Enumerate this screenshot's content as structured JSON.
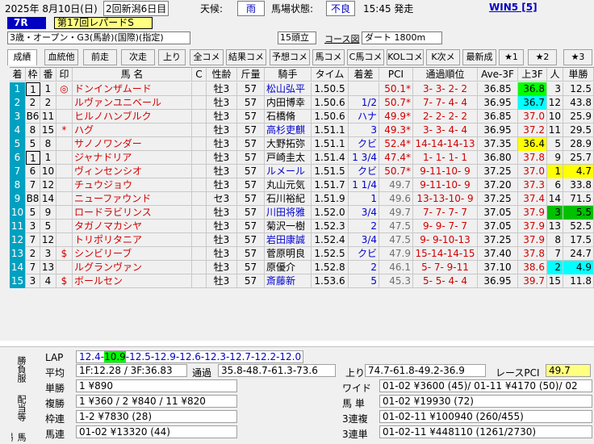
{
  "header": {
    "date": "2025年 8月10日(日)",
    "meeting": "2回新潟6日目",
    "weather_label": "天候:",
    "weather": "雨",
    "track_label": "馬場状態:",
    "track": "不良",
    "start_time": "15:45 発走",
    "win5": "WIN5 [5]"
  },
  "race": {
    "number": "7R",
    "name": "第17回レパードS",
    "conditions": "3歳・オープン・G3(馬齢)(国際)(指定)",
    "runners": "15頭立",
    "course_link": "コース図",
    "distance": "ダート 1800m"
  },
  "tabs": [
    "成績",
    "血統他",
    "前走",
    "次走",
    "上り",
    "全コメ",
    "結果コメ",
    "予想コメ",
    "馬コメ",
    "C馬コメ",
    "KOLコメ",
    "K次メモ",
    "最新成",
    "★1",
    "★2",
    "★3"
  ],
  "columns": {
    "rank": "着",
    "frame": "枠",
    "num": "番",
    "mark": "印",
    "name": "馬 名",
    "c": "C",
    "sex_age": "性齢",
    "weight": "斤量",
    "jockey": "騎手",
    "time": "タイム",
    "margin": "着差",
    "pci": "PCI",
    "passing": "通過順位",
    "ave3f": "Ave-3F",
    "last3f": "上3F",
    "pop": "人",
    "odds": "単勝"
  },
  "runners": [
    {
      "rank": "1",
      "frame": "1",
      "num": "1",
      "mark": "◎",
      "name": "ドンインザムード",
      "c": "",
      "sex_age": "牡3",
      "weight": "57",
      "jockey": "松山弘平",
      "time": "1.50.5",
      "margin": "",
      "pci": "50.1*",
      "passing": "3- 3- 2- 2",
      "ave3f": "36.85",
      "last3f": "36.8",
      "pop": "3",
      "odds": "12.5"
    },
    {
      "rank": "2",
      "frame": "2",
      "num": "2",
      "mark": "",
      "name": "ルヴァンユニベール",
      "c": "",
      "sex_age": "牡3",
      "weight": "57",
      "jockey": "内田博幸",
      "time": "1.50.6",
      "margin": "1/2",
      "pci": "50.7*",
      "passing": "7- 7- 4- 4",
      "ave3f": "36.95",
      "last3f": "36.7",
      "pop": "12",
      "odds": "43.8"
    },
    {
      "rank": "3",
      "frame": "B6",
      "num": "11",
      "mark": "",
      "name": "ヒルノハンブルク",
      "c": "",
      "sex_age": "牡3",
      "weight": "57",
      "jockey": "石橋脩",
      "time": "1.50.6",
      "margin": "ハナ",
      "pci": "49.9*",
      "passing": "2- 2- 2- 2",
      "ave3f": "36.85",
      "last3f": "37.0",
      "pop": "10",
      "odds": "25.9"
    },
    {
      "rank": "4",
      "frame": "8",
      "num": "15",
      "mark": "*",
      "name": "ハグ",
      "c": "",
      "sex_age": "牡3",
      "weight": "57",
      "jockey": "高杉吏麒",
      "time": "1.51.1",
      "margin": "3",
      "pci": "49.3*",
      "passing": "3- 3- 4- 4",
      "ave3f": "36.95",
      "last3f": "37.2",
      "pop": "11",
      "odds": "29.5"
    },
    {
      "rank": "5",
      "frame": "5",
      "num": "8",
      "mark": "",
      "name": "サノノワンダー",
      "c": "",
      "sex_age": "牡3",
      "weight": "57",
      "jockey": "大野拓弥",
      "time": "1.51.1",
      "margin": "クビ",
      "pci": "52.4*",
      "passing": "14-14-14-13",
      "ave3f": "37.35",
      "last3f": "36.4",
      "pop": "5",
      "odds": "28.9"
    },
    {
      "rank": "6",
      "frame": "1",
      "num": "1",
      "mark": "",
      "name": "ジャナドリア",
      "c": "",
      "sex_age": "牡3",
      "weight": "57",
      "jockey": "戸崎圭太",
      "time": "1.51.4",
      "margin": "1 3/4",
      "pci": "47.4*",
      "passing": "1- 1- 1- 1",
      "ave3f": "36.80",
      "last3f": "37.8",
      "pop": "9",
      "odds": "25.7"
    },
    {
      "rank": "7",
      "frame": "6",
      "num": "10",
      "mark": "",
      "name": "ヴィンセンシオ",
      "c": "",
      "sex_age": "牡3",
      "weight": "57",
      "jockey": "ルメール",
      "time": "1.51.5",
      "margin": "クビ",
      "pci": "50.7*",
      "passing": "9-11-10- 9",
      "ave3f": "37.25",
      "last3f": "37.0",
      "pop": "1",
      "odds": "4.7"
    },
    {
      "rank": "8",
      "frame": "7",
      "num": "12",
      "mark": "",
      "name": "チュウジョウ",
      "c": "",
      "sex_age": "牡3",
      "weight": "57",
      "jockey": "丸山元気",
      "time": "1.51.7",
      "margin": "1 1/4",
      "pci": "49.7",
      "passing": "9-11-10- 9",
      "ave3f": "37.20",
      "last3f": "37.3",
      "pop": "6",
      "odds": "33.8"
    },
    {
      "rank": "9",
      "frame": "B8",
      "num": "14",
      "mark": "",
      "name": "ニューファウンド",
      "c": "",
      "sex_age": "セ3",
      "weight": "57",
      "jockey": "石川裕紀",
      "time": "1.51.9",
      "margin": "1",
      "pci": "49.6",
      "passing": "13-13-10- 9",
      "ave3f": "37.25",
      "last3f": "37.4",
      "pop": "14",
      "odds": "71.5"
    },
    {
      "rank": "10",
      "frame": "5",
      "num": "9",
      "mark": "",
      "name": "ロードラビリンス",
      "c": "",
      "sex_age": "牡3",
      "weight": "57",
      "jockey": "川田将雅",
      "time": "1.52.0",
      "margin": "3/4",
      "pci": "49.7",
      "passing": "7- 7- 7- 7",
      "ave3f": "37.05",
      "last3f": "37.9",
      "pop": "3",
      "odds": "5.5"
    },
    {
      "rank": "11",
      "frame": "3",
      "num": "5",
      "mark": "",
      "name": "タガノマカシヤ",
      "c": "",
      "sex_age": "牡3",
      "weight": "57",
      "jockey": "菊沢一樹",
      "time": "1.52.3",
      "margin": "2",
      "pci": "47.5",
      "passing": "9- 9- 7- 7",
      "ave3f": "37.05",
      "last3f": "37.9",
      "pop": "13",
      "odds": "52.5"
    },
    {
      "rank": "12",
      "frame": "7",
      "num": "12",
      "mark": "",
      "name": "トリポリタニア",
      "c": "",
      "sex_age": "牡3",
      "weight": "57",
      "jockey": "岩田康誠",
      "time": "1.52.4",
      "margin": "3/4",
      "pci": "47.5",
      "passing": "9- 9-10-13",
      "ave3f": "37.25",
      "last3f": "37.9",
      "pop": "8",
      "odds": "17.5"
    },
    {
      "rank": "13",
      "frame": "2",
      "num": "3",
      "mark": "$",
      "name": "シンビリーブ",
      "c": "",
      "sex_age": "牡3",
      "weight": "57",
      "jockey": "菅原明良",
      "time": "1.52.5",
      "margin": "クビ",
      "pci": "47.9",
      "passing": "15-14-14-15",
      "ave3f": "37.40",
      "last3f": "37.8",
      "pop": "7",
      "odds": "24.7"
    },
    {
      "rank": "14",
      "frame": "7",
      "num": "13",
      "mark": "",
      "name": "ルグランヴァン",
      "c": "",
      "sex_age": "牡3",
      "weight": "57",
      "jockey": "原優介",
      "time": "1.52.8",
      "margin": "2",
      "pci": "46.1",
      "passing": "5- 7- 9-11",
      "ave3f": "37.10",
      "last3f": "38.6",
      "pop": "2",
      "odds": "4.9"
    },
    {
      "rank": "15",
      "frame": "3",
      "num": "4",
      "mark": "$",
      "name": "ボールセン",
      "c": "",
      "sex_age": "牡3",
      "weight": "57",
      "jockey": "斎藤新",
      "time": "1.53.6",
      "margin": "5",
      "pci": "45.3",
      "passing": "5- 5- 4- 4",
      "ave3f": "36.95",
      "last3f": "39.7",
      "pop": "15",
      "odds": "11.8"
    }
  ],
  "colors": {
    "last3f_green": "#00ff00",
    "last3f_cyan": "#00ffff",
    "last3f_yellow": "#ffff00",
    "pop_yellow": "#ffff00",
    "pop_green": "#00c000",
    "pop_cyan": "#00ffff",
    "rank_cyan_bg": "#00a0c0"
  },
  "bottom": {
    "vtab1": "勝負服",
    "vtab2": "配当等",
    "vtab3": "馬場外",
    "lap_label": "LAP",
    "lap_pre": "12.4-",
    "lap_hl": "10.9",
    "lap_post": "-12.5-12.9-12.6-12.3-12.7-12.2-12.0",
    "avg_label": "平均",
    "avg": "1F:12.28 / 3F:36.83",
    "pass_label": "通過",
    "pass": "35.8-48.7-61.3-73.6",
    "up_label": "上り",
    "up": "74.7-61.8-49.2-36.9",
    "race_pci_label": "レースPCI",
    "race_pci": "49.7",
    "win_label": "単勝",
    "win": "1 ¥890",
    "place_label": "複勝",
    "place": "1 ¥360 / 2 ¥840 / 11 ¥820",
    "bracket_label": "枠連",
    "bracket": "1-2 ¥7830 (28)",
    "quinella_label": "馬連",
    "quinella": "01-02 ¥13320 (44)",
    "wide_label": "ワイド",
    "wide": "01-02 ¥3600 (45)/ 01-11 ¥4170 (50)/ 02",
    "exacta_label": "馬 単",
    "exacta": "01-02 ¥19930 (72)",
    "trio_label": "3連複",
    "trio": "01-02-11 ¥100940 (260/455)",
    "trifecta_label": "3連単",
    "trifecta": "01-02-11 ¥448110 (1261/2730)"
  }
}
